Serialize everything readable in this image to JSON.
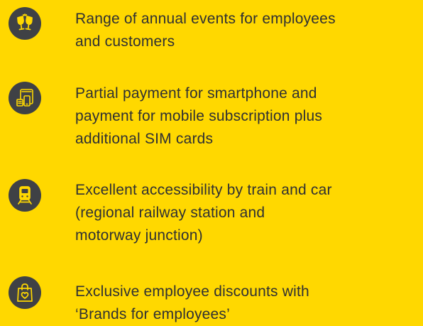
{
  "colors": {
    "background": "#FFD800",
    "icon_circle": "#3f4145",
    "icon_glyph": "#FFD800",
    "text": "#2f3033"
  },
  "items": [
    {
      "icon": "champagne-glasses-icon",
      "text": "Range of annual events for employees\nand customers"
    },
    {
      "icon": "mobile-devices-icon",
      "text": "Partial payment for smartphone and\npayment for mobile subscription plus\nadditional SIM cards"
    },
    {
      "icon": "train-icon",
      "text": "Excellent accessibility by train and car\n(regional railway station and\nmotorway junction)"
    },
    {
      "icon": "shopping-bag-heart-icon",
      "text": "Exclusive employee discounts with\n‘Brands for employees’"
    }
  ]
}
